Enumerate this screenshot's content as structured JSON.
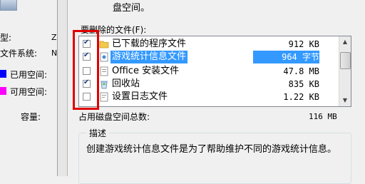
{
  "bg_window": {
    "labels": [
      "型:",
      "文件系统:",
      "已用空间:",
      "可用空间:",
      "容量:"
    ],
    "value_partial_1": "Z",
    "value_partial_2": "N",
    "used_color": "#0000ff",
    "free_color": "#ff00ff"
  },
  "dialog": {
    "top_text": "盘空间。",
    "list_label": "要删除的文件(F):",
    "files": [
      {
        "name": "已下载的程序文件",
        "size": "912 KB",
        "checked": true,
        "icon": "folder-icon"
      },
      {
        "name": "游戏统计信息文件",
        "size": "964 字节",
        "checked": true,
        "icon": "game-file-icon"
      },
      {
        "name": "Office 安装文件",
        "size": "47.8 MB",
        "checked": false,
        "icon": "office-icon"
      },
      {
        "name": "回收站",
        "size": "835 KB",
        "checked": true,
        "icon": "recycle-bin-icon"
      },
      {
        "name": "设置日志文件",
        "size": "1.22 KB",
        "checked": false,
        "icon": "log-file-icon"
      }
    ],
    "total_label": "占用磁盘空间总数:",
    "total_value": "116 MB",
    "desc_title": "描述",
    "desc_text": "创建游戏统计信息文件是为了帮助维护不同的游戏统计信息。",
    "highlight_color": "#e10000"
  }
}
